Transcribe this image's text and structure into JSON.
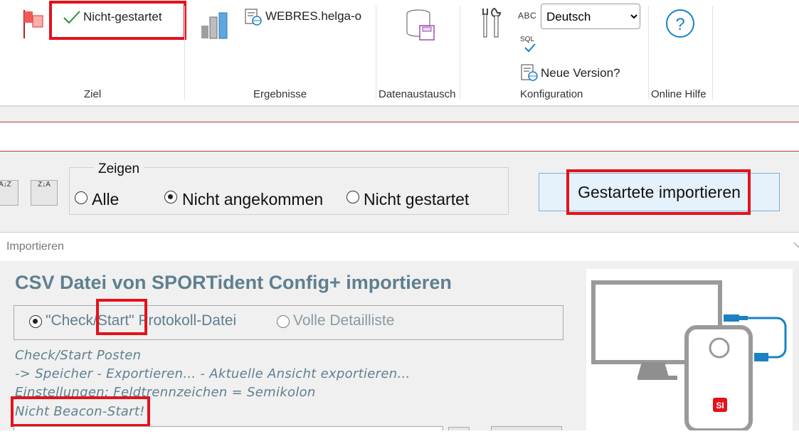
{
  "ribbon": {
    "ziel": {
      "status_label": "Nicht-gestartet",
      "group_label": "Ziel"
    },
    "ergebnisse": {
      "file_label": "WEBRES.helga-o",
      "group_label": "Ergebnisse"
    },
    "datenaustausch": {
      "group_label": "Datenaustausch"
    },
    "konfiguration": {
      "abc_label": "ABC",
      "sql_label": "SQL",
      "language_selected": "Deutsch",
      "new_version_label": "Neue Version?",
      "group_label": "Konfiguration"
    },
    "hilfe": {
      "icon_text": "?",
      "group_label": "Online Hilfe"
    }
  },
  "filter": {
    "sort_az": "A↓Z",
    "sort_za": "Z↓A",
    "group_title": "Zeigen",
    "options": [
      "Alle",
      "Nicht angekommen",
      "Nicht gestartet"
    ],
    "selected": "Nicht angekommen",
    "import_button": "Gestartete importieren"
  },
  "dialog": {
    "title": "Importieren",
    "heading": "CSV Datei von SPORTident Config+ importieren",
    "option_check_start": "\"Check/Start\" Protokoll-Datei",
    "option_full": "Volle Detailliste",
    "selected_option": "\"Check/Start\" Protokoll-Datei",
    "info_lines": [
      "Check/Start Posten",
      "-> Speicher - Exportieren... - Aktuelle Ansicht exportieren...",
      "Einstellungen: Feldtrennzeichen = Semikolon",
      "Nicht Beacon-Start!"
    ],
    "device_logo": "SI"
  },
  "colors": {
    "highlight": "#e3121b",
    "heading": "#5f7f8f",
    "button_bg": "#e5f1fb",
    "accent_blue": "#1a82c4"
  }
}
